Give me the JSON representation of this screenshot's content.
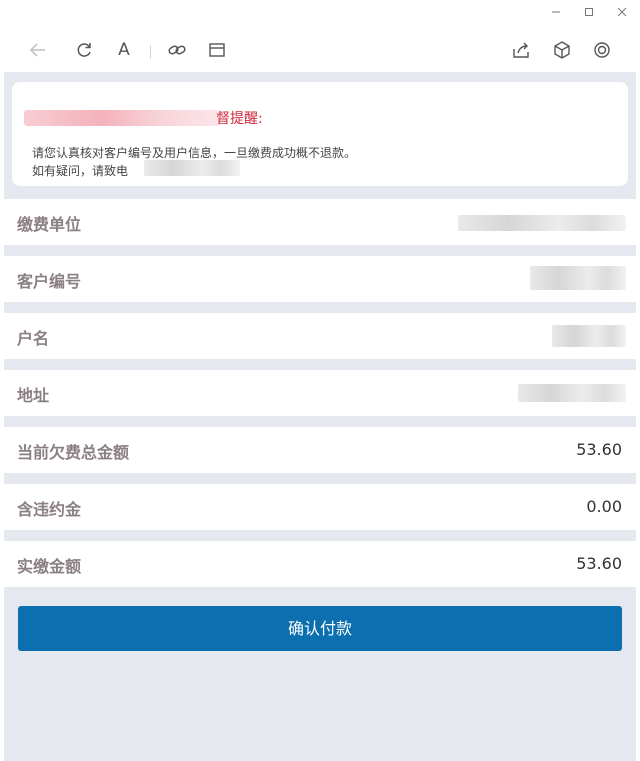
{
  "window": {
    "minimize_icon": "minimize-icon",
    "maximize_icon": "maximize-icon",
    "close_icon": "close-icon"
  },
  "toolbar": {
    "icons": [
      "back-arrow-icon",
      "refresh-icon",
      "font-size-icon",
      "link-icon",
      "window-icon",
      "share-icon",
      "cube-icon",
      "settings-icon"
    ],
    "font_glyph": "A"
  },
  "notice": {
    "title": "督提醒:",
    "line1": "请您认真核对客户编号及用户信息，一旦缴费成功概不退款。",
    "line2": "如有疑问，请致电"
  },
  "rows": [
    {
      "label": "缴费单位",
      "value": ""
    },
    {
      "label": "客户编号",
      "value": ""
    },
    {
      "label": "户名",
      "value": ""
    },
    {
      "label": "地址",
      "value": ""
    },
    {
      "label": "当前欠费总金额",
      "value": "53.60"
    },
    {
      "label": "含违约金",
      "value": "0.00"
    },
    {
      "label": "实缴金额",
      "value": "53.60"
    }
  ],
  "confirm_button": "确认付款",
  "colors": {
    "accent": "#0b6fb0",
    "alert": "#d0273b",
    "background": "#e5e8ee",
    "label": "#8b7f86"
  }
}
